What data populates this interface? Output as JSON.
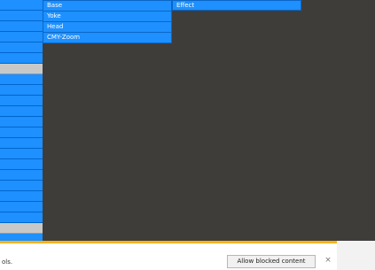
{
  "menu": {
    "items": [
      "Base",
      "Yoke",
      "Head",
      "CMY-Zoom"
    ]
  },
  "effect": {
    "label": "Effect"
  },
  "security_bar": {
    "text": "ols.",
    "allow_button": "Allow blocked content",
    "close": "×"
  },
  "colors": {
    "cell_blue": "#1e90ff",
    "dark_bg": "#3f3d3a",
    "warning_border": "#f6b31c"
  }
}
